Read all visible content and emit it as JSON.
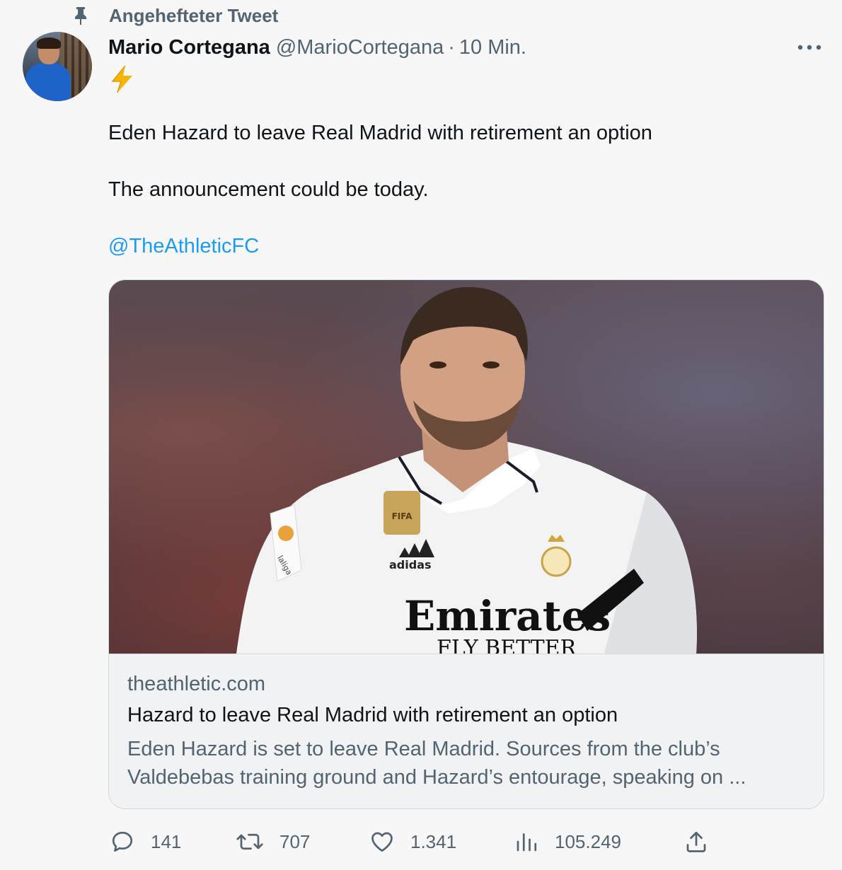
{
  "pinned": {
    "label": "Angehefteter Tweet",
    "icon": "pin-icon"
  },
  "author": {
    "name": "Mario Cortegana",
    "handle": "@MarioCortegana",
    "separator": "·",
    "time": "10 Min."
  },
  "tweet": {
    "lines": [
      "Eden Hazard to leave Real Madrid with retirement an option",
      "The announcement could be today."
    ],
    "mention": "@TheAthleticFC"
  },
  "card": {
    "domain": "theathletic.com",
    "title": "Hazard to leave Real Madrid with retirement an option",
    "description_lines": [
      "Eden Hazard is set to leave Real Madrid. Sources from the club’s",
      "Valdebebas training ground and Hazard’s entourage, speaking on ..."
    ],
    "image_text": {
      "sponsor": "Emirates",
      "sponsor_sub": "FLY BETTER",
      "brand": "adidas",
      "badge": "FIFA",
      "league": "laliga"
    }
  },
  "actions": {
    "replies": "141",
    "retweets": "707",
    "likes": "1.341",
    "views": "105.249"
  },
  "colors": {
    "accent": "#1d9bf0",
    "secondary_text": "#536471",
    "bolt": "#f7b500"
  }
}
